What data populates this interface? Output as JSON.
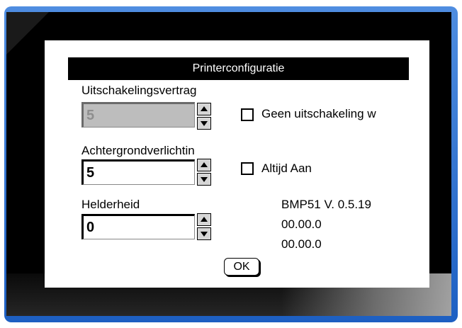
{
  "dialog": {
    "title": "Printerconfiguratie",
    "shutdown_delay": {
      "label": "Uitschakelingsvertrag",
      "value": "5",
      "checkbox_label": "Geen uitschakeling w"
    },
    "backlight": {
      "label": "Achtergrondverlichtin",
      "value": "5",
      "checkbox_label": "Altijd Aan"
    },
    "brightness": {
      "label": "Helderheid",
      "value": "0"
    },
    "info": {
      "version": "BMP51 V. 0.5.19",
      "line2": "00.00.0",
      "line3": "00.00.0"
    },
    "ok_label": "OK"
  }
}
